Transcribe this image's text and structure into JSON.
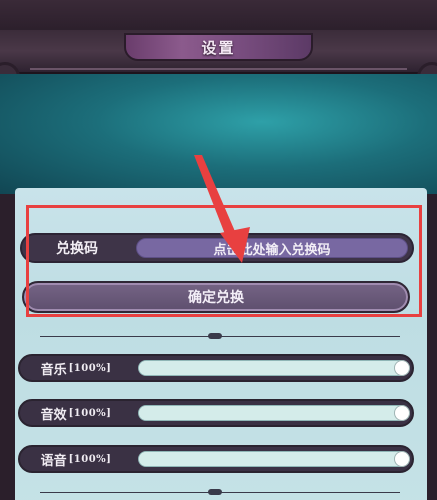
{
  "header": {
    "title": "设置"
  },
  "redeem": {
    "label": "兑换码",
    "input_placeholder": "点击此处输入兑换码",
    "confirm_label": "确定兑换"
  },
  "sliders": [
    {
      "label": "音乐",
      "percent_text": "[100%]",
      "value": 1.0
    },
    {
      "label": "音效",
      "percent_text": "[100%]",
      "value": 1.0
    },
    {
      "label": "语音",
      "percent_text": "[100%]",
      "value": 1.0
    }
  ],
  "colors": {
    "highlight": "#e84040",
    "panel": "#c6e2e7",
    "row": "#3a3144",
    "input": "#7868a2"
  }
}
